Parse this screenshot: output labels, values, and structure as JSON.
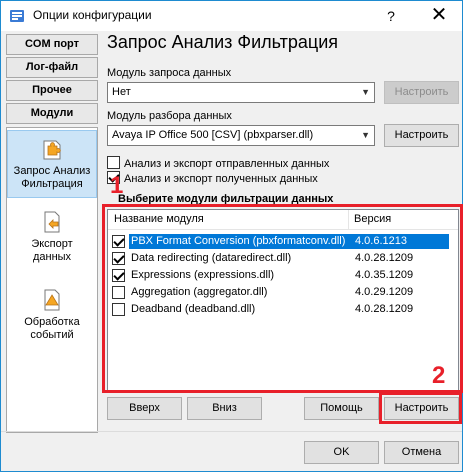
{
  "window": {
    "title": "Опции конфигурации",
    "help_glyph": "?",
    "close_glyph": "✕"
  },
  "nav": {
    "buttons": [
      "COM порт",
      "Лог-файл",
      "Прочее",
      "Модули"
    ],
    "items": [
      {
        "label_lines": [
          "Запрос Анализ",
          "Фильтрация"
        ],
        "icon": "puzzle-icon",
        "active": true
      },
      {
        "label_lines": [
          "Экспорт",
          "данных"
        ],
        "icon": "export-icon",
        "active": false
      },
      {
        "label_lines": [
          "Обработка",
          "событий"
        ],
        "icon": "event-icon",
        "active": false
      }
    ]
  },
  "main": {
    "title": "Запрос Анализ Фильтрация",
    "query_module": {
      "label": "Модуль запроса данных",
      "value": "Нет",
      "button": "Настроить"
    },
    "parser_module": {
      "label": "Модуль разбора данных",
      "value": "Avaya IP Office 500 [CSV] (pbxparser.dll)",
      "button": "Настроить"
    },
    "checks": [
      {
        "label": "Анализ и экспорт отправленных данных",
        "checked": false
      },
      {
        "label": "Анализ и экспорт полученных данных",
        "checked": true
      }
    ],
    "filter_section_title": "Выберите модули фильтрации данных",
    "table": {
      "columns": [
        "Название модуля",
        "Версия"
      ],
      "rows": [
        {
          "name": "PBX Format Conversion (pbxformatconv.dll)",
          "version": "4.0.6.1213",
          "checked": true,
          "selected": true
        },
        {
          "name": "Data redirecting (dataredirect.dll)",
          "version": "4.0.28.1209",
          "checked": true,
          "selected": false
        },
        {
          "name": "Expressions (expressions.dll)",
          "version": "4.0.35.1209",
          "checked": true,
          "selected": false
        },
        {
          "name": "Aggregation (aggregator.dll)",
          "version": "4.0.29.1209",
          "checked": false,
          "selected": false
        },
        {
          "name": "Deadband (deadband.dll)",
          "version": "4.0.28.1209",
          "checked": false,
          "selected": false
        }
      ]
    },
    "buttons": {
      "up": "Вверх",
      "down": "Вниз",
      "help": "Помощь",
      "configure": "Настроить"
    },
    "annotations": {
      "one": "1",
      "two": "2"
    }
  },
  "footer": {
    "ok": "OK",
    "cancel": "Отмена"
  },
  "colors": {
    "accent": "#0078d7",
    "annotation": "#e8202a",
    "window_border": "#1e8bd0"
  }
}
